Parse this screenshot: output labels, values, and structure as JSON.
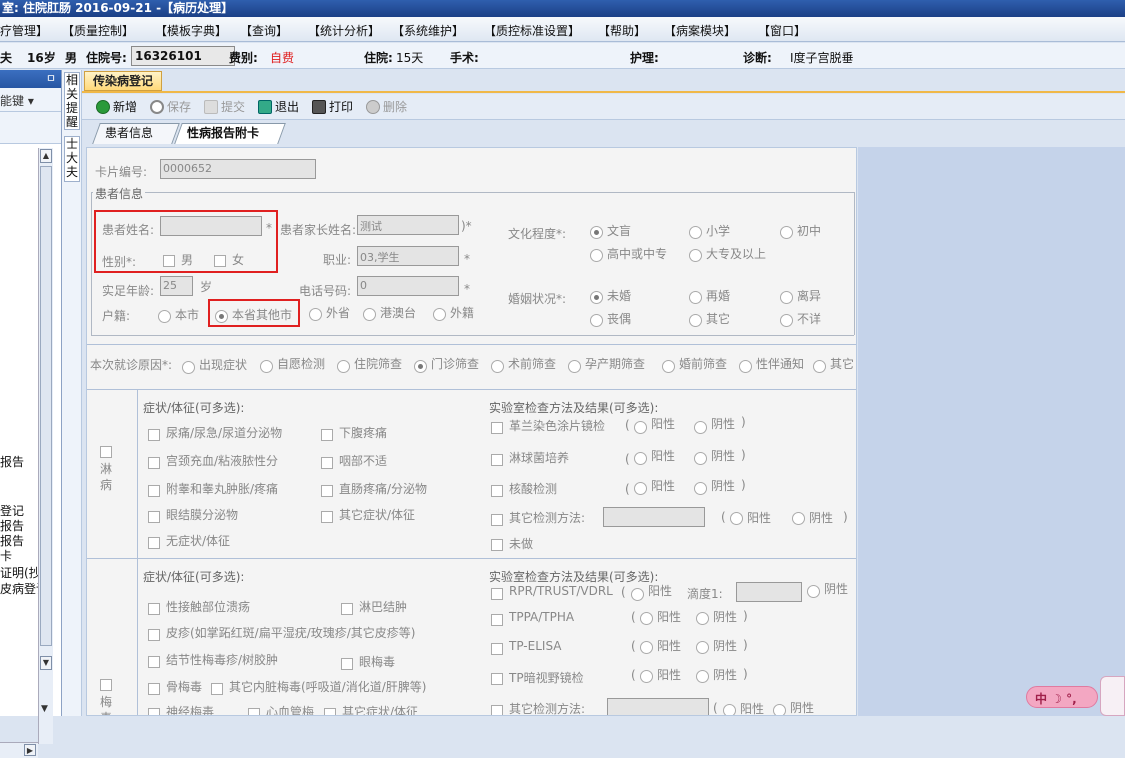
{
  "titlebar": {
    "text": "室: 住院肛肠 2016-09-21 -【病历处理】"
  },
  "menu": [
    "疗管理】",
    "【质量控制】",
    "【模板字典】",
    "【查询】",
    "【统计分析】",
    "【系统维护】",
    "【质控标准设置】",
    "【帮助】",
    "【病案模块】",
    "【窗口】"
  ],
  "patient": {
    "name_frag": "夫",
    "age": "16岁",
    "sex": "男",
    "inpatient_no_label": "住院号:",
    "inpatient_no": "16326101",
    "fee_label": "费别:",
    "fee": "自费",
    "stay_label": "住院:",
    "stay": "15天",
    "surgery_label": "手术:",
    "surgery": "",
    "care_label": "护理:",
    "care": "",
    "diag_label": "诊断:",
    "diag": "I度子宫脱垂"
  },
  "leftpanel": {
    "pin": "ㅁ",
    "dropdown": "能键 ▾",
    "items": [
      "报告",
      "登记",
      "报告",
      "报告",
      "卡",
      "证明(抄",
      "皮病登讫"
    ]
  },
  "sidetabs": [
    "相关提醒",
    "士大夫"
  ],
  "doc_tab": "传染病登记",
  "toolbar": {
    "new": "新增",
    "save": "保存",
    "submit": "提交",
    "exit": "退出",
    "print": "打印",
    "delete": "删除"
  },
  "subtabs": [
    "患者信息",
    "性病报告附卡"
  ],
  "form": {
    "card_no_label": "卡片编号:",
    "card_no": "0000652",
    "patient_info_title": "患者信息",
    "patient_name_label": "患者姓名:",
    "patient_name": "",
    "required_star": "*",
    "parent_name_label": "患者家长姓名:",
    "parent_name": "测试",
    "parent_name_suffix": ")*",
    "sex_label": "性别*:",
    "sex_male": "男",
    "sex_female": "女",
    "job_label": "职业:",
    "job": "03,学生",
    "age_label": "实足年龄:",
    "age": "25",
    "age_unit": "岁",
    "phone_label": "电话号码:",
    "phone": "0",
    "household_label": "户籍:",
    "household_options": [
      "本市",
      "本省其他市",
      "外省",
      "港澳台",
      "外籍"
    ],
    "edu_label": "文化程度*:",
    "edu_options": [
      "文盲",
      "小学",
      "初中",
      "高中或中专",
      "大专及以上"
    ],
    "marital_label": "婚姻状况*:",
    "marital_options": [
      "未婚",
      "再婚",
      "离异",
      "丧偶",
      "其它",
      "不详"
    ],
    "visit_reason_label": "本次就诊原因*:",
    "visit_reasons": [
      "出现症状",
      "自愿检测",
      "住院筛查",
      "门诊筛查",
      "术前筛查",
      "孕产期筛查",
      "婚前筛查",
      "性伴通知",
      "其它"
    ],
    "gonorrhea": {
      "name": "淋病",
      "symptom_title": "症状/体征(可多选):",
      "symptoms_left": [
        "尿痛/尿急/尿道分泌物",
        "宫颈充血/粘液脓性分",
        "附睾和睾丸肿胀/疼痛",
        "眼结膜分泌物",
        "无症状/体征"
      ],
      "symptoms_right": [
        "下腹疼痛",
        "咽部不适",
        "直肠疼痛/分泌物",
        "其它症状/体征"
      ],
      "lab_title": "实验室检查方法及结果(可多选):",
      "lab_tests": [
        "革兰染色涂片镜检",
        "淋球菌培养",
        "核酸检测"
      ],
      "other_method": "其它检测方法:",
      "not_done": "未做",
      "positive": "阳性",
      "negative": "阴性"
    },
    "syphilis": {
      "name": "梅毒",
      "symptom_title": "症状/体征(可多选):",
      "symptoms": [
        "性接触部位溃疡",
        "淋巴结肿",
        "皮疹(如掌跖红斑/扁平湿疣/玫瑰疹/其它皮疹等)",
        "结节性梅毒疹/树胶肿",
        "眼梅毒",
        "骨梅毒",
        "其它内脏梅毒(呼吸道/消化道/肝脾等)",
        "神经梅毒",
        "心血管梅",
        "其它症状/体征"
      ],
      "lab_title": "实验室检查方法及结果(可多选):",
      "lab_tests": [
        "RPR/TRUST/VDRL",
        "TPPA/TPHA",
        "TP-ELISA",
        "TP暗视野镜检"
      ],
      "titer_label": "滴度1:",
      "other_method": "其它检测方法:",
      "positive": "阳性",
      "negative": "阴性"
    }
  },
  "ime": {
    "label": "中 ☽ °,"
  }
}
